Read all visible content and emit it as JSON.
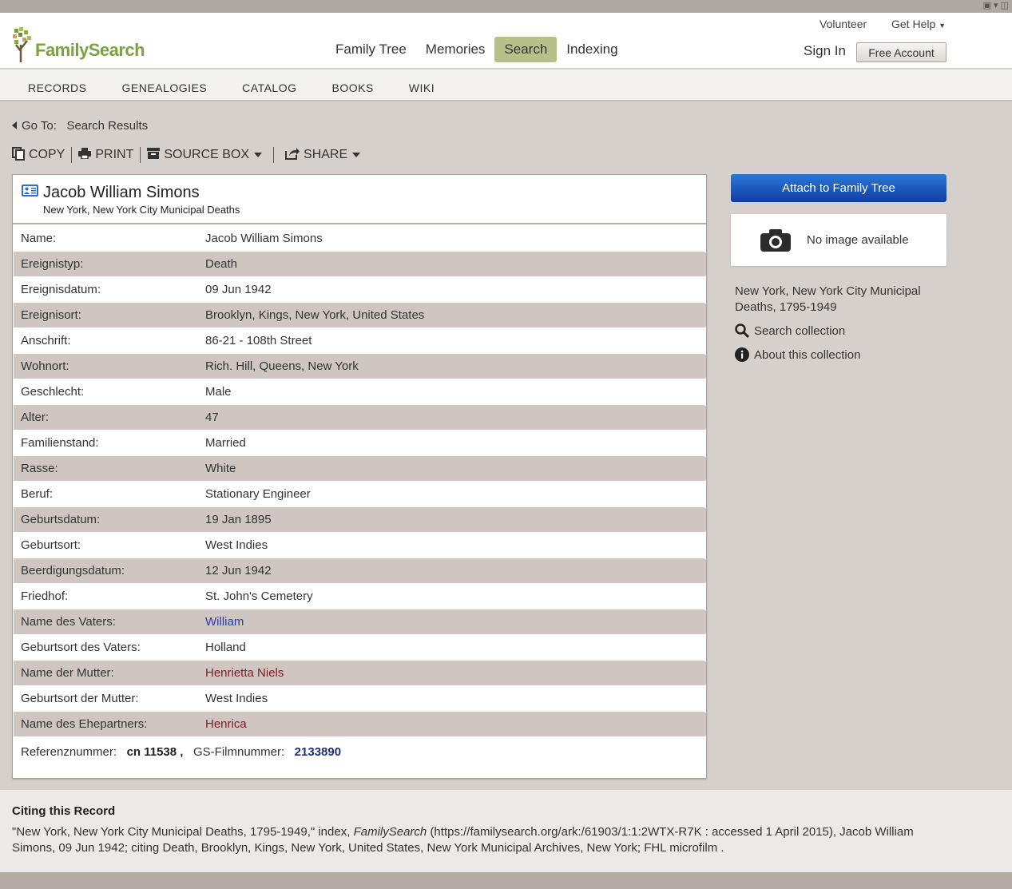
{
  "brand": {
    "logo_text": "FamilySearch"
  },
  "main_nav": [
    {
      "label": "Family Tree"
    },
    {
      "label": "Memories"
    },
    {
      "label": "Search"
    },
    {
      "label": "Indexing"
    }
  ],
  "utility": {
    "volunteer": "Volunteer",
    "get_help": "Get Help",
    "sign_in": "Sign In",
    "free_account": "Free Account"
  },
  "sub_nav": [
    {
      "label": "RECORDS"
    },
    {
      "label": "GENEALOGIES"
    },
    {
      "label": "CATALOG"
    },
    {
      "label": "BOOKS"
    },
    {
      "label": "WIKI"
    }
  ],
  "goto": {
    "label": "Go To:",
    "link": "Search Results"
  },
  "toolbar": {
    "copy": "COPY",
    "print": "PRINT",
    "source_box": "SOURCE BOX",
    "share": "SHARE"
  },
  "record": {
    "name": "Jacob William Simons",
    "collection": "New York, New York City Municipal Deaths",
    "rows": [
      {
        "label": "Name:",
        "value": "Jacob William Simons"
      },
      {
        "label": "Ereignistyp:",
        "value": "Death"
      },
      {
        "label": "Ereignisdatum:",
        "value": "09 Jun 1942"
      },
      {
        "label": "Ereignisort:",
        "value": "Brooklyn, Kings, New York, United States"
      },
      {
        "label": "Anschrift:",
        "value": "86-21 - 108th Street"
      },
      {
        "label": "Wohnort:",
        "value": "Rich. Hill, Queens, New York"
      },
      {
        "label": "Geschlecht:",
        "value": "Male"
      },
      {
        "label": "Alter:",
        "value": "47"
      },
      {
        "label": "Familienstand:",
        "value": "Married"
      },
      {
        "label": "Rasse:",
        "value": "White"
      },
      {
        "label": "Beruf:",
        "value": "Stationary Engineer"
      },
      {
        "label": "Geburtsdatum:",
        "value": "19 Jan 1895"
      },
      {
        "label": "Geburtsort:",
        "value": "West Indies"
      },
      {
        "label": "Beerdigungsdatum:",
        "value": "12 Jun 1942"
      },
      {
        "label": "Friedhof:",
        "value": "St. John's Cemetery"
      },
      {
        "label": "Name des Vaters:",
        "value": "William"
      },
      {
        "label": "Geburtsort des Vaters:",
        "value": "Holland"
      },
      {
        "label": "Name der Mutter:",
        "value": "Henrietta Niels"
      },
      {
        "label": "Geburtsort der Mutter:",
        "value": "West Indies"
      },
      {
        "label": "Name des Ehepartners:",
        "value": "Henrica"
      }
    ],
    "reference": {
      "ref_label": "Referenznummer:",
      "ref_value": "cn 11538",
      "sep": ",",
      "film_label": "GS-Filmnummer:",
      "film_value": "2133890"
    }
  },
  "sidebar": {
    "attach_button": "Attach to Family Tree",
    "no_image": "No image available",
    "collection_title": "New York, New York City Municipal Deaths, 1795-1949",
    "search_collection": "Search collection",
    "about_collection": "About this collection"
  },
  "citation": {
    "heading": "Citing this Record",
    "text_1": "\"New York, New York City Municipal Deaths, 1795-1949,\" index,",
    "text_italic": "FamilySearch",
    "text_2": "(https://familysearch.org/ark:/61903/1:1:2WTX-R7K : accessed 1 April 2015), Jacob William Simons, 09 Jun 1942; citing Death, Brooklyn, Kings, New York, United States, New York Municipal Archives, New York; FHL microfilm ."
  },
  "colors": {
    "accent_search": "#b8c08a",
    "attach_blue": "#1a56c0",
    "link_blue": "#2a3fa0",
    "link_red": "#7a1d2b",
    "row_alt": "#cfc5c1"
  }
}
